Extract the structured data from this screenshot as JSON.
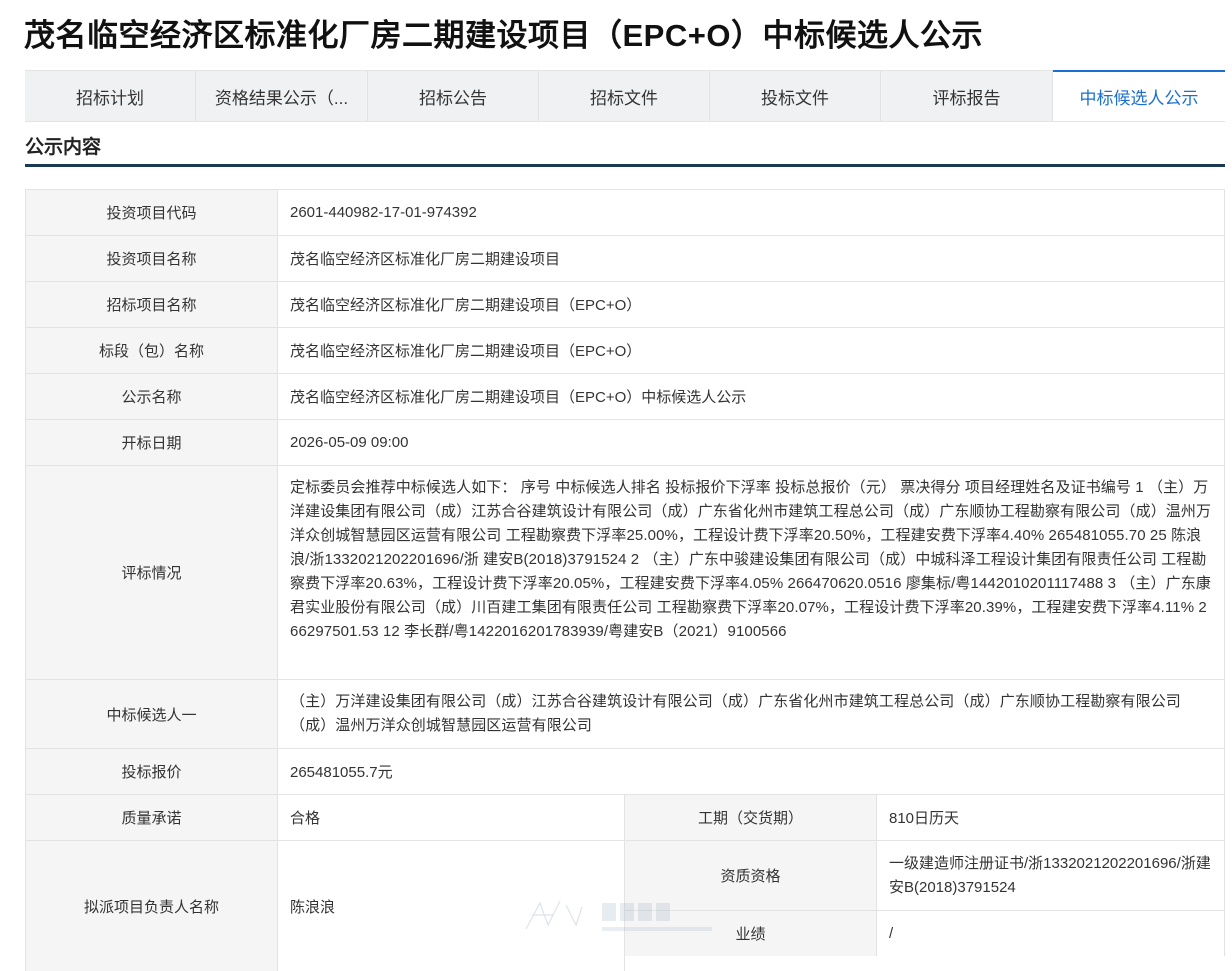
{
  "page": {
    "title": "茂名临空经济区标准化厂房二期建设项目（EPC+O）中标候选人公示"
  },
  "tabs": [
    {
      "label": "招标计划"
    },
    {
      "label": "资格结果公示（..."
    },
    {
      "label": "招标公告"
    },
    {
      "label": "招标文件"
    },
    {
      "label": "投标文件"
    },
    {
      "label": "评标报告"
    },
    {
      "label": "中标候选人公示"
    }
  ],
  "section": {
    "title": "公示内容"
  },
  "rows": {
    "project_code": {
      "label": "投资项目代码",
      "value": "2601-440982-17-01-974392"
    },
    "project_name": {
      "label": "投资项目名称",
      "value": "茂名临空经济区标准化厂房二期建设项目"
    },
    "tender_name": {
      "label": "招标项目名称",
      "value": "茂名临空经济区标准化厂房二期建设项目（EPC+O）"
    },
    "section_name": {
      "label": "标段（包）名称",
      "value": "茂名临空经济区标准化厂房二期建设项目（EPC+O）"
    },
    "notice_name": {
      "label": "公示名称",
      "value": "茂名临空经济区标准化厂房二期建设项目（EPC+O）中标候选人公示"
    },
    "open_date": {
      "label": "开标日期",
      "value": "2026-05-09 09:00"
    },
    "evaluation": {
      "label": "评标情况",
      "value": "定标委员会推荐中标候选人如下： 序号 中标候选人排名 投标报价下浮率 投标总报价（元） 票决得分 项目经理姓名及证书编号 1 （主）万洋建设集团有限公司（成）江苏合谷建筑设计有限公司（成）广东省化州市建筑工程总公司（成）广东顺协工程勘察有限公司（成）温州万洋众创城智慧园区运营有限公司 工程勘察费下浮率25.00%，工程设计费下浮率20.50%，工程建安费下浮率4.40% 265481055.70 25 陈浪浪/浙1332021202201696/浙 建安B(2018)3791524 2 （主）广东中骏建设集团有限公司（成）中城科泽工程设计集团有限责任公司 工程勘察费下浮率20.63%，工程设计费下浮率20.05%，工程建安费下浮率4.05% 266470620.0516 廖集标/粤1442010201117488 3 （主）广东康君实业股份有限公司（成）川百建工集团有限责任公司 工程勘察费下浮率20.07%，工程设计费下浮率20.39%，工程建安费下浮率4.11% 266297501.53 12 李长群/粤1422016201783939/粤建安B（2021）9100566"
    },
    "candidate1": {
      "label": "中标候选人一",
      "value": "（主）万洋建设集团有限公司（成）江苏合谷建筑设计有限公司（成）广东省化州市建筑工程总公司（成）广东顺协工程勘察有限公司（成）温州万洋众创城智慧园区运营有限公司"
    },
    "bid_price": {
      "label": "投标报价",
      "value": "265481055.7元"
    },
    "quality": {
      "label": "质量承诺",
      "value": "合格"
    },
    "duration": {
      "label": "工期（交货期）",
      "value": "810日历天"
    },
    "manager": {
      "label": "拟派项目负责人名称",
      "value": "陈浪浪"
    },
    "qualification": {
      "label": "资质资格",
      "value": "一级建造师注册证书/浙1332021202201696/浙建安B(2018)3791524"
    },
    "performance": {
      "label": "业绩",
      "value": "/"
    }
  }
}
